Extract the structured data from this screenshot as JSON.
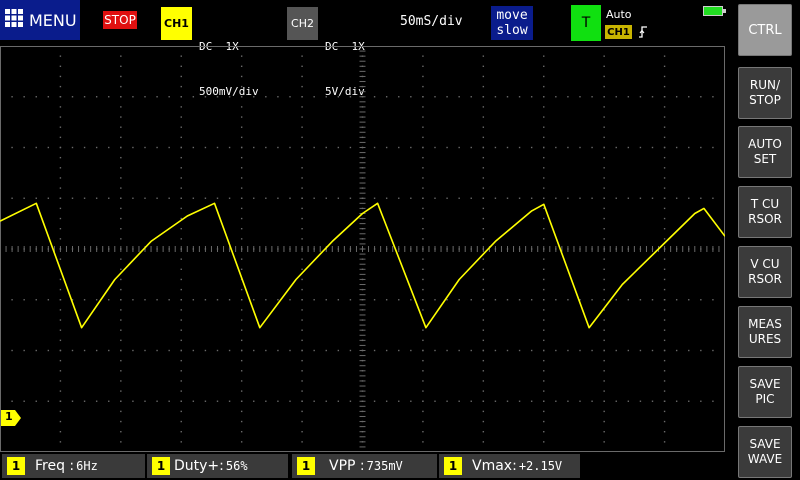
{
  "topbar": {
    "menu_label": "MENU",
    "run_state": "STOP",
    "ch1": {
      "label": "CH1",
      "coupling": "DC  1X",
      "scale": "500mV/div"
    },
    "ch2": {
      "label": "CH2",
      "coupling": "DC  1X",
      "scale": "5V/div"
    },
    "timebase": "50mS/div",
    "move_mode": {
      "line1": "move",
      "line2": "slow"
    },
    "trigger": {
      "label": "T",
      "mode": "Auto",
      "source": "CH1",
      "edge": "rising-edge-icon"
    }
  },
  "side_buttons": [
    {
      "id": "ctrl",
      "label": "CTRL"
    },
    {
      "id": "run-stop",
      "label": "RUN/\nSTOP"
    },
    {
      "id": "auto-set",
      "label": "AUTO\nSET"
    },
    {
      "id": "t-cursor",
      "label": "T CU\nRSOR"
    },
    {
      "id": "v-cursor",
      "label": "V CU\nRSOR"
    },
    {
      "id": "measures",
      "label": "MEAS\nURES"
    },
    {
      "id": "save-pic",
      "label": "SAVE\nPIC"
    },
    {
      "id": "save-wave",
      "label": "SAVE\nWAVE"
    }
  ],
  "measurements": [
    {
      "ch": "1",
      "label": "Freq",
      "value": "6Hz"
    },
    {
      "ch": "1",
      "label": "Duty+",
      "value": "56%"
    },
    {
      "ch": "1",
      "label": "VPP",
      "value": "735mV"
    },
    {
      "ch": "1",
      "label": "Vmax",
      "value": "+2.15V"
    }
  ],
  "channel_marker": "1",
  "colors": {
    "ch1": "#ffff00",
    "stop": "#e01010",
    "trigger": "#10e010",
    "menu": "#0a1c8c",
    "grid": "#6a6a6a",
    "measure_bg": "#3a3a3a"
  },
  "chart_data": {
    "type": "line",
    "title": "",
    "xlabel": "",
    "ylabel": "",
    "grid": true,
    "divisions": {
      "x": 12,
      "y": 8
    },
    "xlim": [
      0,
      12
    ],
    "ylim": [
      -4,
      4
    ],
    "series": [
      {
        "color": "#ffff00",
        "points": [
          [
            0,
            0.55
          ],
          [
            0.6,
            0.9
          ],
          [
            1.35,
            -1.55
          ],
          [
            1.9,
            -0.6
          ],
          [
            2.5,
            0.15
          ],
          [
            3.1,
            0.65
          ],
          [
            3.55,
            0.9
          ],
          [
            4.3,
            -1.55
          ],
          [
            4.9,
            -0.6
          ],
          [
            5.5,
            0.15
          ],
          [
            6.0,
            0.7
          ],
          [
            6.25,
            0.9
          ],
          [
            7.05,
            -1.55
          ],
          [
            7.6,
            -0.6
          ],
          [
            8.2,
            0.15
          ],
          [
            8.8,
            0.75
          ],
          [
            9.0,
            0.88
          ],
          [
            9.75,
            -1.55
          ],
          [
            10.3,
            -0.7
          ],
          [
            10.9,
            0.0
          ],
          [
            11.5,
            0.7
          ],
          [
            11.65,
            0.8
          ],
          [
            12.0,
            0.25
          ]
        ]
      }
    ]
  }
}
